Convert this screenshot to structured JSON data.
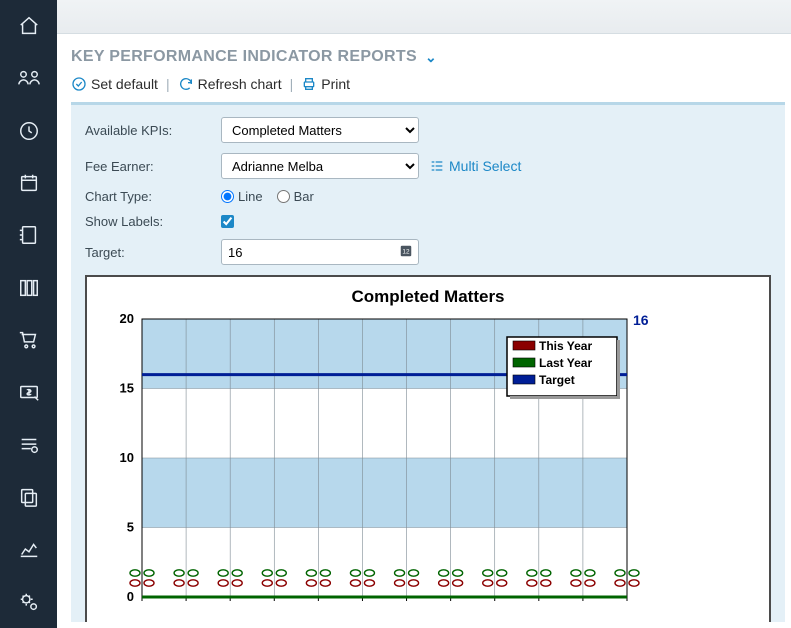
{
  "page": {
    "title": "KEY PERFORMANCE INDICATOR REPORTS"
  },
  "toolbar": {
    "set_default": "Set default",
    "refresh": "Refresh chart",
    "print": "Print"
  },
  "form": {
    "available_kpis_label": "Available KPIs:",
    "available_kpis_value": "Completed Matters",
    "fee_earner_label": "Fee Earner:",
    "fee_earner_value": "Adrianne Melba",
    "multi_select_label": "Multi Select",
    "chart_type_label": "Chart Type:",
    "chart_type_line": "Line",
    "chart_type_bar": "Bar",
    "show_labels_label": "Show Labels:",
    "target_label": "Target:",
    "target_value": "16"
  },
  "chart_data": {
    "type": "line",
    "title": "Completed Matters",
    "ylim": [
      0,
      20
    ],
    "yticks": [
      0,
      5,
      10,
      15,
      20
    ],
    "x_count": 12,
    "legend_position": "upper-right",
    "target_annotation": "16",
    "series": [
      {
        "name": "This Year",
        "color": "#8b0000",
        "values": [
          0,
          0,
          0,
          0,
          0,
          0,
          0,
          0,
          0,
          0,
          0,
          0
        ]
      },
      {
        "name": "Last Year",
        "color": "#006400",
        "values": [
          0,
          0,
          0,
          0,
          0,
          0,
          0,
          0,
          0,
          0,
          0,
          0
        ]
      },
      {
        "name": "Target",
        "color": "#001e96",
        "values": [
          16,
          16,
          16,
          16,
          16,
          16,
          16,
          16,
          16,
          16,
          16,
          16
        ]
      }
    ]
  },
  "sidebar": {
    "items": [
      {
        "name": "home"
      },
      {
        "name": "people"
      },
      {
        "name": "clock"
      },
      {
        "name": "calendar"
      },
      {
        "name": "ledger"
      },
      {
        "name": "books"
      },
      {
        "name": "cart"
      },
      {
        "name": "money"
      },
      {
        "name": "settings-list"
      },
      {
        "name": "copy"
      },
      {
        "name": "chart"
      },
      {
        "name": "gears"
      }
    ]
  }
}
